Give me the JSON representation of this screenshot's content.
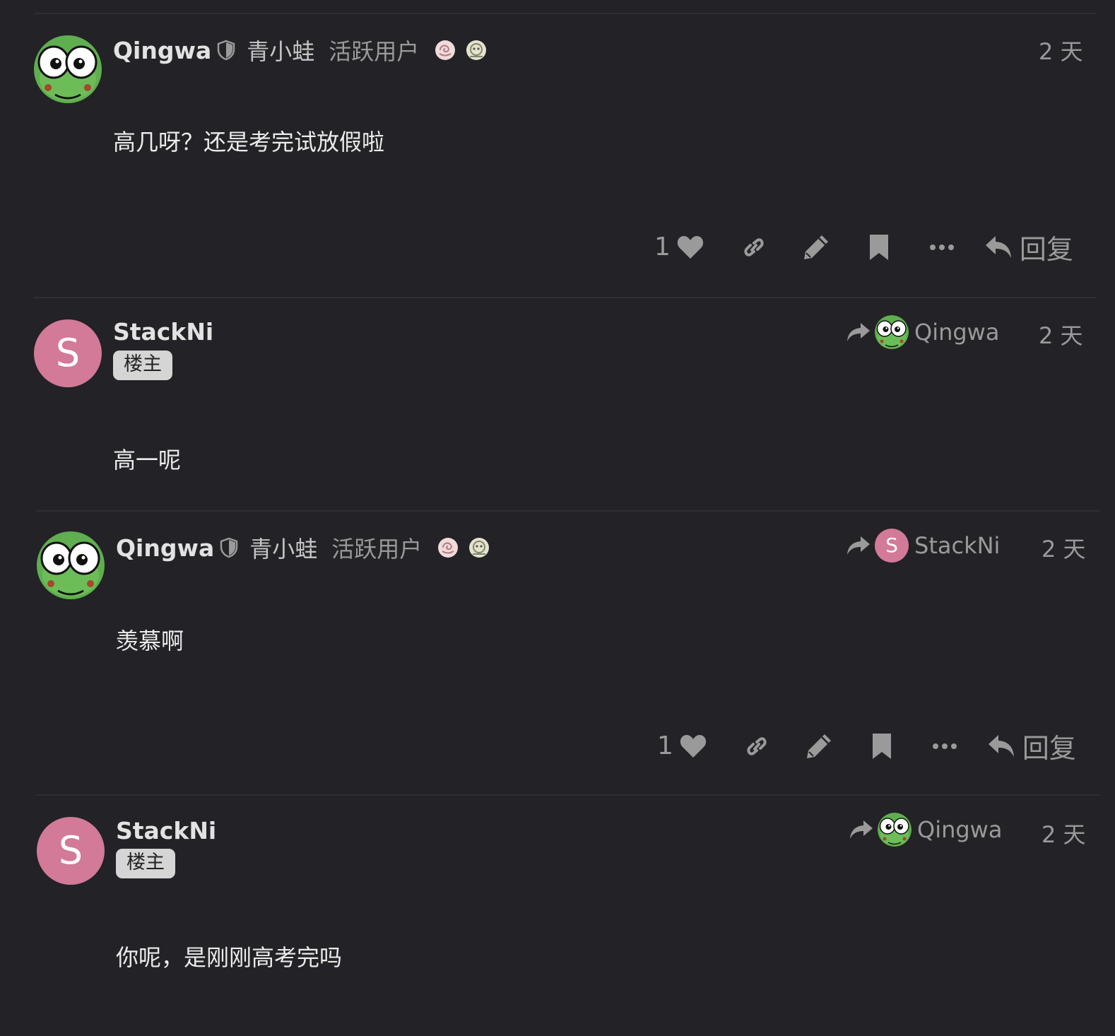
{
  "posts": [
    {
      "username": "Qingwa",
      "full_name": "青小蛙",
      "user_title": "活跃用户",
      "date": "2 天",
      "content": "高几呀？还是考完试放假啦",
      "like_count": "1",
      "reply_label": "回复"
    },
    {
      "username": "StackNi",
      "avatar_letter": "S",
      "op_tag": "楼主",
      "reply_to_name": "Qingwa",
      "date": "2 天",
      "content": "高一呢"
    },
    {
      "username": "Qingwa",
      "full_name": "青小蛙",
      "user_title": "活跃用户",
      "reply_to_name": "StackNi",
      "reply_to_letter": "S",
      "date": "2 天",
      "content": "羡慕啊",
      "like_count": "1",
      "reply_label": "回复"
    },
    {
      "username": "StackNi",
      "avatar_letter": "S",
      "op_tag": "楼主",
      "reply_to_name": "Qingwa",
      "date": "2 天",
      "content": "你呢，是刚刚高考完吗"
    }
  ],
  "colors": {
    "background": "#232226",
    "letter_avatar": "#d27a98",
    "frog_green": "#5fae4f"
  },
  "icons": [
    "shield-icon",
    "heart-icon",
    "link-icon",
    "pencil-icon",
    "bookmark-icon",
    "ellipsis-icon",
    "reply-arrow-icon",
    "share-arrow-icon",
    "badge-icon"
  ]
}
